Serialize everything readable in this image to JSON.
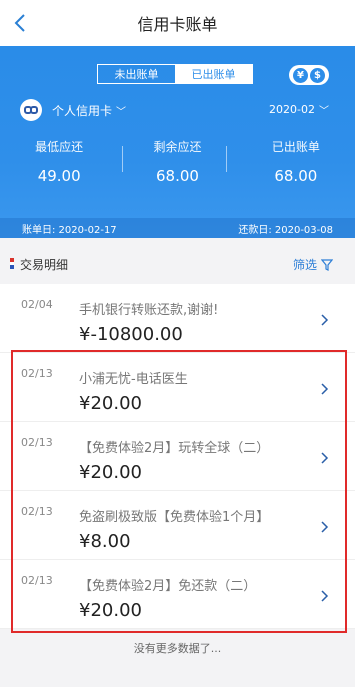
{
  "nav": {
    "title": "信用卡账单",
    "back_icon": "chevron-left-icon"
  },
  "toggle": {
    "unbilled_label": "未出账单",
    "billed_label": "已出账单",
    "active": "billed"
  },
  "currency": {
    "yen": "¥",
    "dollar": "$"
  },
  "card": {
    "name": "个人信用卡",
    "chevron": "﹀"
  },
  "statement_month": {
    "label": "2020-02",
    "chevron": "﹀"
  },
  "stats": [
    {
      "label": "最低应还",
      "value": "49.00"
    },
    {
      "label": "剩余应还",
      "value": "68.00"
    },
    {
      "label": "已出账单",
      "value": "68.00"
    }
  ],
  "bill_bar": {
    "bill_date": "账单日: 2020-02-17",
    "due_date": "还款日: 2020-03-08"
  },
  "section": {
    "title": "交易明细",
    "filter_label": "筛选"
  },
  "transactions": [
    {
      "date": "02/04",
      "desc": "手机银行转账还款,谢谢!",
      "amount": "¥-10800.00"
    },
    {
      "date": "02/13",
      "desc": "小浦无忧-电话医生",
      "amount": "¥20.00"
    },
    {
      "date": "02/13",
      "desc": "【免费体验2月】玩转全球（二）",
      "amount": "¥20.00"
    },
    {
      "date": "02/13",
      "desc": "免盗刷极致版【免费体验1个月】",
      "amount": "¥8.00"
    },
    {
      "date": "02/13",
      "desc": "【免费体验2月】免还款（二）",
      "amount": "¥20.00"
    }
  ],
  "footer": {
    "note": "没有更多数据了..."
  },
  "colors": {
    "primary": "#2d8ee9",
    "highlight": "#e02a2a",
    "filter": "#2d7ed6"
  }
}
